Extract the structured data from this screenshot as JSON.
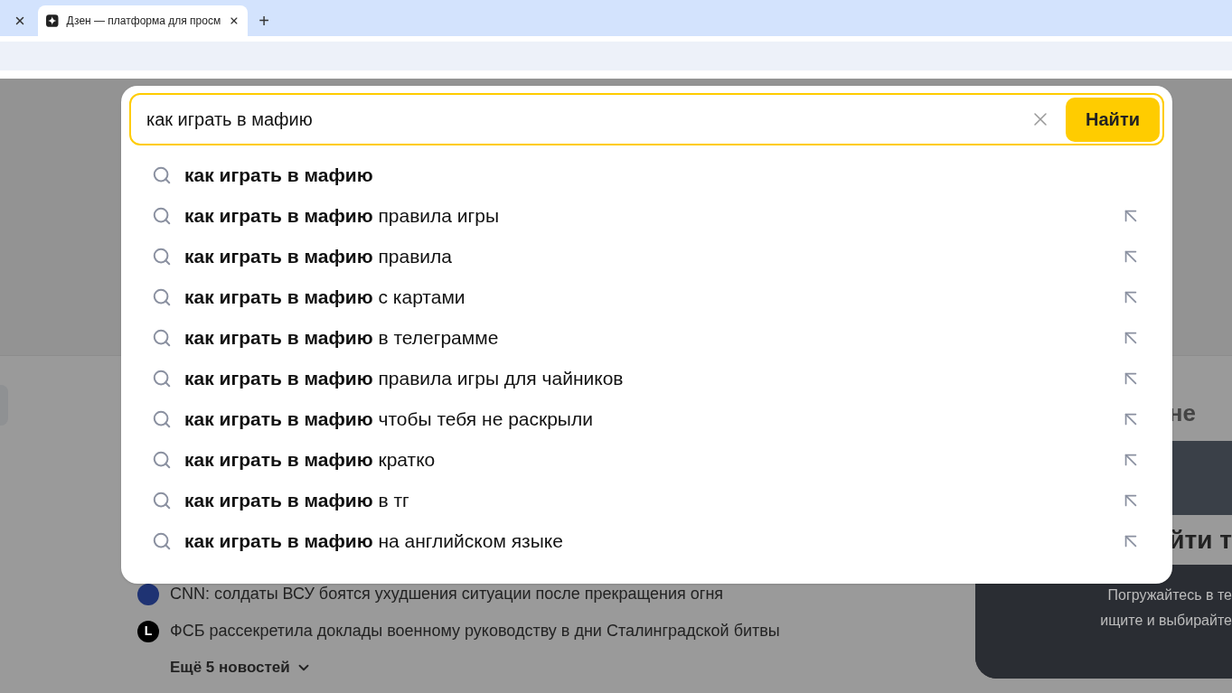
{
  "browser": {
    "tabs": [
      {
        "kind": "narrow",
        "selected": false
      },
      {
        "kind": "normal",
        "title": "Дзен — платформа для просм",
        "selected": true
      }
    ],
    "new_tab": "+"
  },
  "search": {
    "query": "как играть в мафию",
    "button": "Найти",
    "suggestions": [
      {
        "kind": "exact",
        "text": "**как играть в мафию**"
      },
      {
        "kind": "completion",
        "text": "**как играть в мафию** правила игры"
      },
      {
        "kind": "completion",
        "text": "**как играть в мафию** правила"
      },
      {
        "kind": "completion",
        "text": "**как играть в мафию** с картами"
      },
      {
        "kind": "completion",
        "text": "**как играть в мафию** в телеграмме"
      },
      {
        "kind": "completion",
        "text": "**как играть в мафию** правила игры для чайников"
      },
      {
        "kind": "completion",
        "text": "**как играть в мафию** чтобы тебя не раскрыли"
      },
      {
        "kind": "completion",
        "text": "**как играть в мафию** кратко"
      },
      {
        "kind": "completion",
        "text": "**как играть в мафию** в тг"
      },
      {
        "kind": "completion",
        "text": "**как играть в мафию** на английском языке"
      }
    ]
  },
  "page": {
    "news": [
      {
        "text": "CNN: солдаты ВСУ боятся ухудшения ситуации после прекращения огня",
        "color": "#1f3373"
      },
      {
        "text": "ФСБ рассекретила доклады военному руководству в дни Сталинградской битвы",
        "badge": "L",
        "color": "#000000"
      }
    ],
    "more_news": "Ещё 5 новостей",
    "side_heading": "не",
    "promo": {
      "title": "йти т",
      "lines": [
        "Погружайтесь в те",
        "ищите и выбирайте"
      ]
    }
  }
}
